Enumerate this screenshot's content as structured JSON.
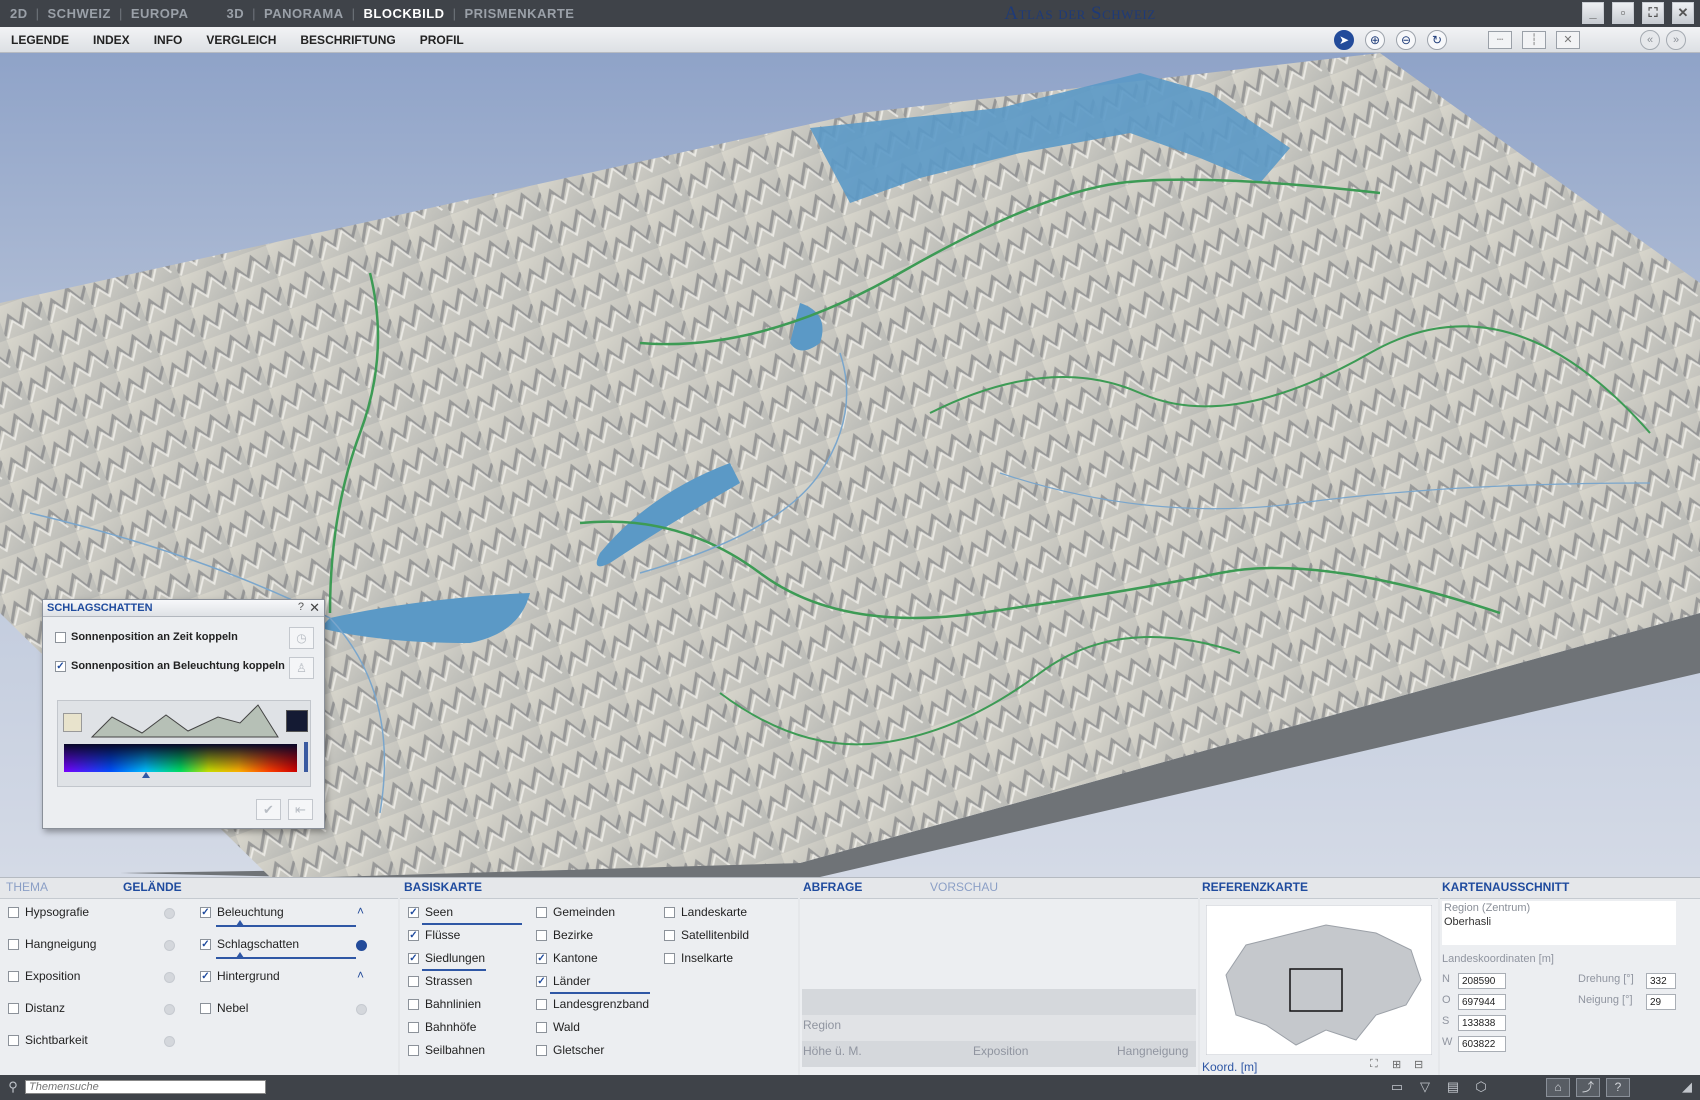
{
  "titlebar": {
    "mode_2d": "2D",
    "nav_2d": [
      "SCHWEIZ",
      "EUROPA"
    ],
    "mode_3d": "3D",
    "nav_3d": [
      "PANORAMA",
      "BLOCKBILD",
      "PRISMENKARTE"
    ],
    "active": "BLOCKBILD",
    "app_title": "Atlas der Schweiz"
  },
  "menu": [
    "LEGENDE",
    "INDEX",
    "INFO",
    "VERGLEICH",
    "BESCHRIFTUNG",
    "PROFIL"
  ],
  "toolbar_icons": [
    "pointer-icon",
    "zoom-in-icon",
    "zoom-out-icon",
    "rotate-icon",
    "split-horizontal-icon",
    "split-vertical-icon",
    "close-view-icon",
    "back-icon",
    "forward-icon"
  ],
  "dialog": {
    "title": "SCHLAGSCHATTEN",
    "opt1": {
      "label": "Sonnenposition an Zeit koppeln",
      "checked": false
    },
    "opt2": {
      "label": "Sonnenposition an Beleuchtung koppeln",
      "checked": true
    },
    "light_color": "#e8e3cc",
    "shadow_color": "#141a33"
  },
  "tabs": {
    "thema": "THEMA",
    "gelaende": "GELÄNDE",
    "basiskarte": "BASISKARTE",
    "abfrage": "ABFRAGE",
    "vorschau": "VORSCHAU",
    "referenzkarte": "REFERENZKARTE",
    "kartenausschnitt": "KARTENAUSSCHNITT"
  },
  "gelaende_left": [
    {
      "label": "Hypsografie",
      "checked": false
    },
    {
      "label": "Hangneigung",
      "checked": false
    },
    {
      "label": "Exposition",
      "checked": false
    },
    {
      "label": "Distanz",
      "checked": false
    },
    {
      "label": "Sichtbarkeit",
      "checked": false
    }
  ],
  "gelaende_right": [
    {
      "label": "Beleuchtung",
      "checked": true
    },
    {
      "label": "Schlagschatten",
      "checked": true
    },
    {
      "label": "Hintergrund",
      "checked": true
    },
    {
      "label": "Nebel",
      "checked": false
    }
  ],
  "basiskarte_col1": [
    {
      "label": "Seen",
      "checked": true
    },
    {
      "label": "Flüsse",
      "checked": true
    },
    {
      "label": "Siedlungen",
      "checked": true
    },
    {
      "label": "Strassen",
      "checked": false
    },
    {
      "label": "Bahnlinien",
      "checked": false
    },
    {
      "label": "Bahnhöfe",
      "checked": false
    },
    {
      "label": "Seilbahnen",
      "checked": false
    }
  ],
  "basiskarte_col2": [
    {
      "label": "Gemeinden",
      "checked": false
    },
    {
      "label": "Bezirke",
      "checked": false
    },
    {
      "label": "Kantone",
      "checked": true
    },
    {
      "label": "Länder",
      "checked": true
    },
    {
      "label": "Landesgrenzband",
      "checked": false
    },
    {
      "label": "Wald",
      "checked": false
    },
    {
      "label": "Gletscher",
      "checked": false
    }
  ],
  "basiskarte_col3": [
    {
      "label": "Landeskarte",
      "checked": false
    },
    {
      "label": "Satellitenbild",
      "checked": false
    },
    {
      "label": "Inselkarte",
      "checked": false
    }
  ],
  "abfrage": {
    "region": "Region",
    "hoehe": "Höhe ü. M.",
    "exposition": "Exposition",
    "hangneigung": "Hangneigung"
  },
  "referenz": {
    "koord": "Koord. [m]"
  },
  "ausschnitt": {
    "region_label": "Region (Zentrum)",
    "region_value": "Oberhasli",
    "coords_label": "Landeskoordinaten [m]",
    "N": "208590",
    "O": "697944",
    "S": "133838",
    "W": "603822",
    "drehung_label": "Drehung [°]",
    "drehung": "332",
    "neigung_label": "Neigung [°]",
    "neigung": "29"
  },
  "status": {
    "search_placeholder": "Themensuche"
  }
}
